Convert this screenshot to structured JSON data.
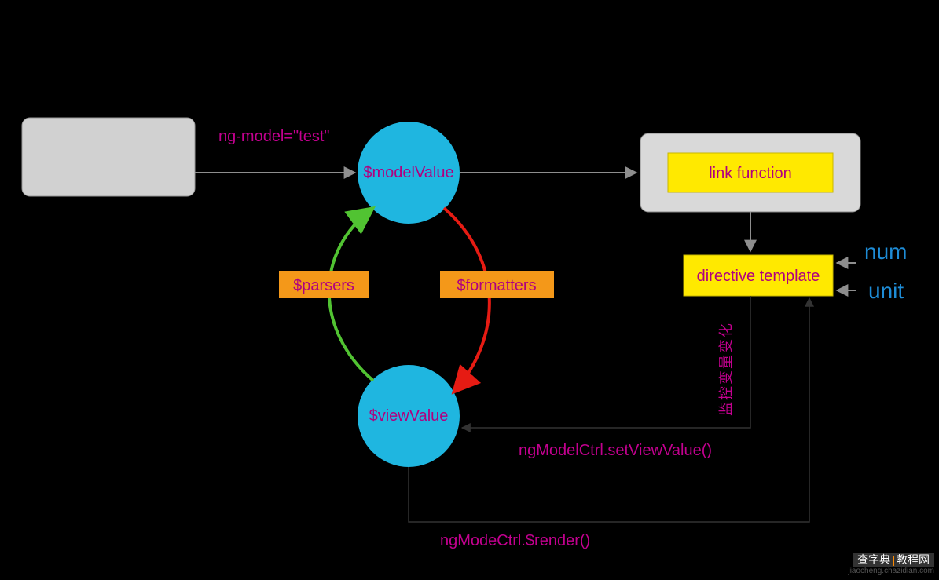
{
  "labels": {
    "ng_model": "ng-model=\"test\"",
    "model_value": "$modelValue",
    "view_value": "$viewValue",
    "parsers": "$parsers",
    "formatters": "$formatters",
    "link_function": "link function",
    "directive_template": "directive template",
    "num": "num",
    "unit": "unit",
    "watch_changes": "监控变量变化",
    "set_view_value": "ngModelCtrl.setViewValue()",
    "render": "ngModeCtrl.$render()"
  },
  "watermark": {
    "site_part1": "查字典",
    "site_part2": "教程网",
    "url": "jiaocheng.chazidian.com"
  },
  "colors": {
    "circle": "#1fb6e0",
    "yellow": "#ffe900",
    "orange": "#f49819",
    "magenta": "#c3008f",
    "gray_arrow": "#8e8e8e",
    "green": "#51c332",
    "red": "#e61b13",
    "dark_arrow": "#333333",
    "blue_text": "#1e8cd6"
  }
}
